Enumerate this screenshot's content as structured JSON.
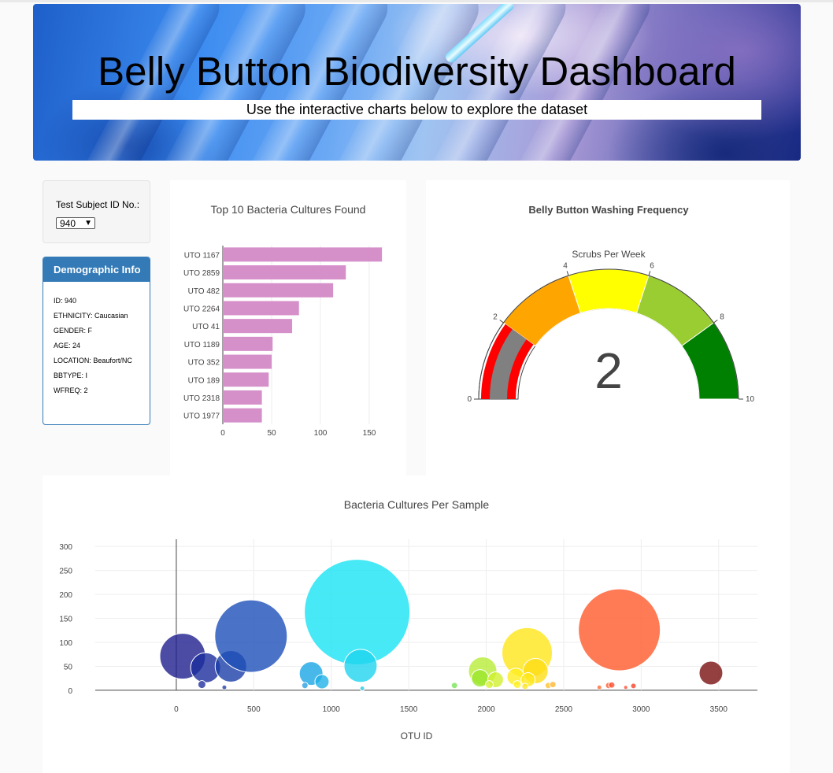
{
  "header": {
    "title": "Belly Button Biodiversity Dashboard",
    "subtitle": "Use the interactive charts below to explore the dataset"
  },
  "selector": {
    "label": "Test Subject ID No.:",
    "selected": "940"
  },
  "demographics": {
    "heading": "Demographic Info",
    "rows": [
      "ID: 940",
      "ETHNICITY: Caucasian",
      "GENDER: F",
      "AGE: 24",
      "LOCATION: Beaufort/NC",
      "BBTYPE: I",
      "WFREQ: 2"
    ]
  },
  "colors": {
    "bar": "#d58fc9",
    "panel_accent": "#337ab7"
  },
  "chart_data": [
    {
      "type": "bar",
      "orientation": "horizontal",
      "title": "Top 10 Bacteria Cultures Found",
      "categories": [
        "UTO 1167",
        "UTO 2859",
        "UTO 482",
        "UTO 2264",
        "UTO 41",
        "UTO 1189",
        "UTO 352",
        "UTO 189",
        "UTO 2318",
        "UTO 1977"
      ],
      "values": [
        163,
        126,
        113,
        78,
        71,
        51,
        50,
        47,
        40,
        40
      ],
      "xlim": [
        0,
        175
      ],
      "xticks": [
        "0",
        "50",
        "100",
        "150"
      ],
      "grid": true
    },
    {
      "type": "gauge",
      "title": "Belly Button Washing Frequency",
      "subtitle": "Scrubs Per Week",
      "value": 2,
      "range": [
        0,
        10
      ],
      "ticks": [
        "0",
        "2",
        "4",
        "6",
        "8",
        "10"
      ],
      "steps": [
        {
          "range": [
            2,
            4
          ],
          "color": "#ffa500"
        },
        {
          "range": [
            4,
            6
          ],
          "color": "#ffff00"
        },
        {
          "range": [
            6,
            8
          ],
          "color": "#9acd32"
        },
        {
          "range": [
            8,
            10
          ],
          "color": "#008000"
        }
      ],
      "bar_color": "#808080",
      "threshold_color": "#ff0000"
    },
    {
      "type": "scatter",
      "title": "Bacteria Cultures Per Sample",
      "xlabel": "OTU ID",
      "xlim": [
        -650,
        3750
      ],
      "ylim": [
        -10,
        315
      ],
      "xticks": [
        0,
        500,
        1000,
        1500,
        2000,
        2500,
        3000,
        3500
      ],
      "yticks": [
        0,
        50,
        100,
        150,
        200,
        250,
        300
      ],
      "points": [
        {
          "x": 41,
          "y": 71,
          "size": 58,
          "color": "#1f1f8f"
        },
        {
          "x": 189,
          "y": 47,
          "size": 38,
          "color": "#1c2d9e"
        },
        {
          "x": 352,
          "y": 50,
          "size": 40,
          "color": "#1a3ea8"
        },
        {
          "x": 482,
          "y": 113,
          "size": 92,
          "color": "#1d4fb8"
        },
        {
          "x": 165,
          "y": 12,
          "size": 10,
          "color": "#2332a0"
        },
        {
          "x": 310,
          "y": 6,
          "size": 6,
          "color": "#2340a6"
        },
        {
          "x": 870,
          "y": 35,
          "size": 30,
          "color": "#1aa6e6"
        },
        {
          "x": 940,
          "y": 18,
          "size": 18,
          "color": "#22b2e8"
        },
        {
          "x": 830,
          "y": 10,
          "size": 8,
          "color": "#2aa0e0"
        },
        {
          "x": 1167,
          "y": 163,
          "size": 134,
          "color": "#19e3f4"
        },
        {
          "x": 1189,
          "y": 51,
          "size": 42,
          "color": "#1fd4ef"
        },
        {
          "x": 1200,
          "y": 4,
          "size": 6,
          "color": "#30c9e8"
        },
        {
          "x": 1795,
          "y": 10,
          "size": 8,
          "color": "#7be35a"
        },
        {
          "x": 1977,
          "y": 40,
          "size": 36,
          "color": "#b9ec3a"
        },
        {
          "x": 1960,
          "y": 25,
          "size": 22,
          "color": "#9be62d"
        },
        {
          "x": 2060,
          "y": 22,
          "size": 20,
          "color": "#cff02f"
        },
        {
          "x": 2020,
          "y": 12,
          "size": 10,
          "color": "#d6f23a"
        },
        {
          "x": 2264,
          "y": 78,
          "size": 64,
          "color": "#ffe61a"
        },
        {
          "x": 2318,
          "y": 40,
          "size": 32,
          "color": "#ffdd16"
        },
        {
          "x": 2190,
          "y": 28,
          "size": 22,
          "color": "#ffee20"
        },
        {
          "x": 2270,
          "y": 22,
          "size": 18,
          "color": "#ffe81e"
        },
        {
          "x": 2200,
          "y": 12,
          "size": 10,
          "color": "#fff226"
        },
        {
          "x": 2250,
          "y": 8,
          "size": 8,
          "color": "#ffe326"
        },
        {
          "x": 2400,
          "y": 10,
          "size": 8,
          "color": "#ffc230"
        },
        {
          "x": 2430,
          "y": 12,
          "size": 8,
          "color": "#ffb732"
        },
        {
          "x": 2859,
          "y": 126,
          "size": 104,
          "color": "#ff5a2a"
        },
        {
          "x": 2730,
          "y": 6,
          "size": 6,
          "color": "#ff6a33"
        },
        {
          "x": 2790,
          "y": 10,
          "size": 8,
          "color": "#ff5b30"
        },
        {
          "x": 2810,
          "y": 11,
          "size": 8,
          "color": "#ff4d2d"
        },
        {
          "x": 2900,
          "y": 6,
          "size": 5,
          "color": "#ff4b2a"
        },
        {
          "x": 2950,
          "y": 9,
          "size": 7,
          "color": "#f6432a"
        },
        {
          "x": 3450,
          "y": 36,
          "size": 30,
          "color": "#7a1010"
        }
      ]
    }
  ]
}
